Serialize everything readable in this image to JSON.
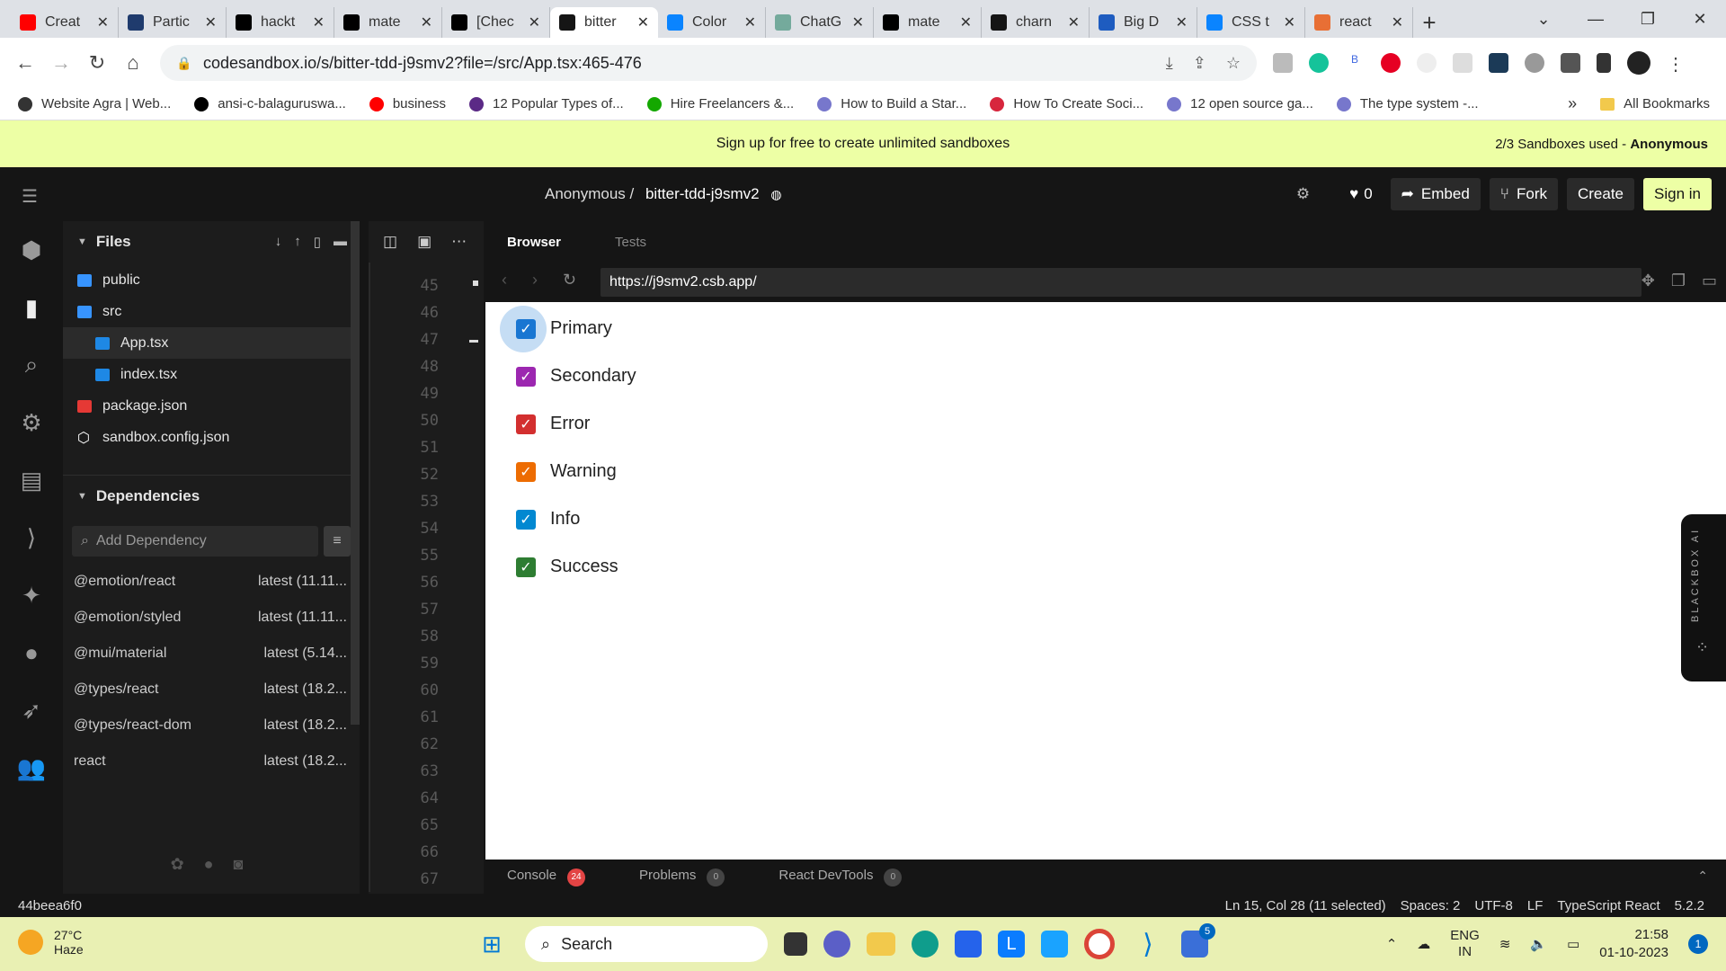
{
  "browser": {
    "tabs": [
      {
        "title": "Creat",
        "color": "#ff0000"
      },
      {
        "title": "Partic",
        "color": "#1f3b6d"
      },
      {
        "title": "hackt",
        "color": "#000000"
      },
      {
        "title": "mate",
        "color": "#000000"
      },
      {
        "title": "[Chec",
        "color": "#000000"
      },
      {
        "title": "bitter",
        "color": "#151515",
        "active": true
      },
      {
        "title": "Color",
        "color": "#0a84ff"
      },
      {
        "title": "ChatG",
        "color": "#74aa9c"
      },
      {
        "title": "mate",
        "color": "#000000"
      },
      {
        "title": "charn",
        "color": "#151515"
      },
      {
        "title": "Big D",
        "color": "#1e5cc0"
      },
      {
        "title": "CSS t",
        "color": "#0a84ff"
      },
      {
        "title": "react",
        "color": "#e86f35"
      }
    ],
    "url": "codesandbox.io/s/bitter-tdd-j9smv2?file=/src/App.tsx:465-476",
    "bookmarks": [
      {
        "label": "Website Agra | Web...",
        "color": "#333333"
      },
      {
        "label": "ansi-c-balaguruswa...",
        "color": "#000000"
      },
      {
        "label": "business",
        "color": "#ff0000"
      },
      {
        "label": "12 Popular Types of...",
        "color": "#5b2a86"
      },
      {
        "label": "Hire Freelancers &...",
        "color": "#14a800"
      },
      {
        "label": "How to Build a Star...",
        "color": "#7777cc"
      },
      {
        "label": "How To Create Soci...",
        "color": "#d7263d"
      },
      {
        "label": "12 open source ga...",
        "color": "#7777cc"
      },
      {
        "label": "The type system -...",
        "color": "#7777cc"
      }
    ],
    "bookmarks_more": "»",
    "all_bookmarks": "All Bookmarks"
  },
  "banner": {
    "text": "Sign up for free to create unlimited sandboxes",
    "usage": "2/3 Sandboxes used - ",
    "user": "Anonymous"
  },
  "header": {
    "owner": "Anonymous /",
    "sandbox": "bitter-tdd-j9smv2",
    "likes": "0",
    "embed": "Embed",
    "fork": "Fork",
    "create": "Create",
    "signin": "Sign in"
  },
  "sidebar": {
    "files_title": "Files",
    "files": [
      {
        "name": "public",
        "indent": 0,
        "type": "folder",
        "color": "#3794ff"
      },
      {
        "name": "src",
        "indent": 0,
        "type": "folder-open",
        "color": "#3794ff"
      },
      {
        "name": "App.tsx",
        "indent": 1,
        "type": "ts",
        "color": "#1e88e5",
        "selected": true
      },
      {
        "name": "index.tsx",
        "indent": 1,
        "type": "ts",
        "color": "#1e88e5"
      },
      {
        "name": "package.json",
        "indent": 0,
        "type": "npm",
        "color": "#e53935"
      },
      {
        "name": "sandbox.config.json",
        "indent": 0,
        "type": "config",
        "color": "#ffffff"
      }
    ],
    "deps_title": "Dependencies",
    "dep_placeholder": "Add Dependency",
    "deps": [
      {
        "name": "@emotion/react",
        "version": "latest (11.11..."
      },
      {
        "name": "@emotion/styled",
        "version": "latest (11.11..."
      },
      {
        "name": "@mui/material",
        "version": "latest (5.14..."
      },
      {
        "name": "@types/react",
        "version": "latest (18.2..."
      },
      {
        "name": "@types/react-dom",
        "version": "latest (18.2..."
      },
      {
        "name": "react",
        "version": "latest (18.2..."
      }
    ]
  },
  "editor": {
    "line_numbers": [
      "45",
      "46",
      "47",
      "48",
      "49",
      "50",
      "51",
      "52",
      "53",
      "54",
      "55",
      "56",
      "57",
      "58",
      "59",
      "60",
      "61",
      "62",
      "63",
      "64",
      "65",
      "66",
      "67"
    ]
  },
  "preview": {
    "tab_browser": "Browser",
    "tab_tests": "Tests",
    "url": "https://j9smv2.csb.app/",
    "checkboxes": [
      {
        "label": "Primary",
        "color": "#1976d2",
        "checked": true,
        "focused": true
      },
      {
        "label": "Secondary",
        "color": "#9c27b0",
        "checked": true
      },
      {
        "label": "Error",
        "color": "#d32f2f",
        "checked": true
      },
      {
        "label": "Warning",
        "color": "#ed6c02",
        "checked": true
      },
      {
        "label": "Info",
        "color": "#0288d1",
        "checked": true
      },
      {
        "label": "Success",
        "color": "#2e7d32",
        "checked": true
      }
    ],
    "ai_tab": "BLACKBOX AI",
    "console": "Console",
    "console_count": "24",
    "problems": "Problems",
    "problems_count": "0",
    "devtools": "React DevTools",
    "devtools_count": "0"
  },
  "status": {
    "commit": "44beea6f0",
    "cursor": "Ln 15, Col 28 (11 selected)",
    "spaces": "Spaces: 2",
    "encoding": "UTF-8",
    "eol": "LF",
    "language": "TypeScript React",
    "version": "5.2.2"
  },
  "taskbar": {
    "temp": "27°C",
    "weather": "Haze",
    "search": "Search",
    "lang1": "ENG",
    "lang2": "IN",
    "time": "21:58",
    "date": "01-10-2023",
    "notif": "1",
    "teams_badge": "5"
  }
}
